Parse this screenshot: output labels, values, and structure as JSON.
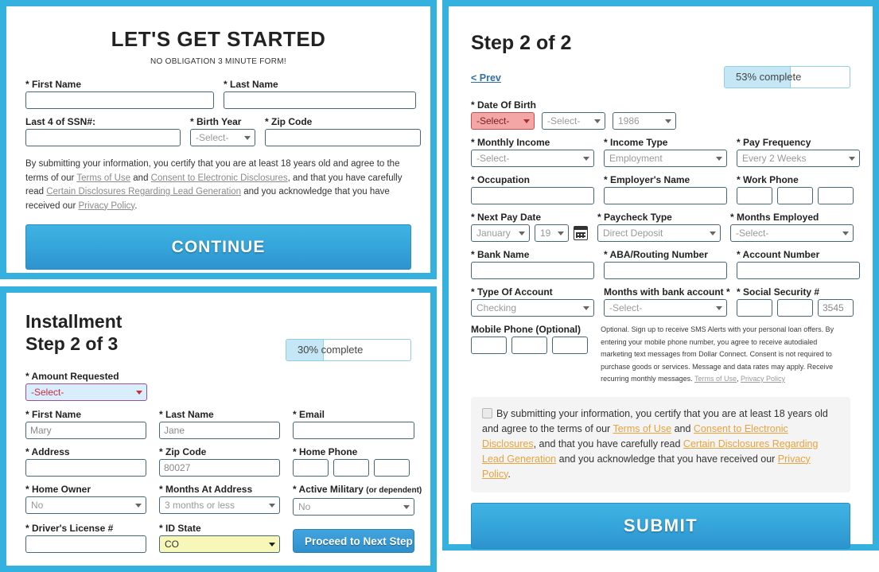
{
  "theme": {
    "frame_blue": "#35b1e0",
    "button_blue": "#35a5da",
    "link_orange": "#e8a33d",
    "error_red": "#f4a6a6",
    "highlight_yellow": "#f7f7b9",
    "progress_fill": "#c5e7f5"
  },
  "start_panel": {
    "title": "LET'S GET STARTED",
    "subtitle": "NO OBLIGATION 3 MINUTE FORM!",
    "fields": {
      "first_name_label": "* First Name",
      "first_name_value": "",
      "last_name_label": "* Last Name",
      "last_name_value": "",
      "ssn_label": "Last 4 of SSN#:",
      "ssn_value": "",
      "birth_year_label": "* Birth Year",
      "birth_year_value": "-Select-",
      "zip_label": "* Zip Code",
      "zip_value": ""
    },
    "disclaimer": {
      "p1": "By submitting your information, you certify that you are at least 18 years old and agree to the terms of our ",
      "link_terms": "Terms of Use",
      "p2": " and ",
      "link_consent": "Consent to Electronic Disclosures",
      "p3": ", and that you have carefully read ",
      "link_lead": "Certain Disclosures Regarding Lead Generation",
      "p4": " and you acknowledge that you have received our ",
      "link_privacy": "Privacy Policy",
      "p5": "."
    },
    "continue_label": "CONTINUE"
  },
  "installment_panel": {
    "title_line1": "Installment",
    "title_line2": "Step 2 of 3",
    "progress_text": "30% complete",
    "progress_percent": 30,
    "fields": {
      "amount_label": "* Amount Requested",
      "amount_value": "-Select-",
      "first_name_label": "* First Name",
      "first_name_value": "Mary",
      "last_name_label": "* Last Name",
      "last_name_value": "Jane",
      "email_label": "* Email",
      "email_value": "",
      "address_label": "* Address",
      "address_value": "",
      "zip_label": "* Zip Code",
      "zip_value": "80027",
      "home_phone_label": "* Home Phone",
      "home_phone_1": "",
      "home_phone_2": "",
      "home_phone_3": "",
      "home_owner_label": "* Home Owner",
      "home_owner_value": "No",
      "months_address_label": "* Months At Address",
      "months_address_value": "3 months or less",
      "military_label": "* Active Military ",
      "military_label_sub": "(or dependent)",
      "military_value": "No",
      "drivers_license_label": "* Driver's License #",
      "drivers_license_value": "",
      "id_state_label": "* ID State",
      "id_state_value": "CO"
    },
    "proceed_label": "Proceed to Next Step"
  },
  "step2_panel": {
    "title": "Step 2 of 2",
    "prev_label": "< Prev",
    "progress_text": "53% complete",
    "progress_percent": 53,
    "fields": {
      "dob_label": "* Date Of Birth",
      "dob_month": "-Select-",
      "dob_day": "-Select-",
      "dob_year": "1986",
      "monthly_income_label": "* Monthly Income",
      "monthly_income_value": "-Select-",
      "income_type_label": "* Income Type",
      "income_type_value": "Employment",
      "pay_frequency_label": "* Pay Frequency",
      "pay_frequency_value": "Every 2 Weeks",
      "occupation_label": "* Occupation",
      "occupation_value": "",
      "employer_label": "* Employer's Name",
      "employer_value": "",
      "work_phone_label": "* Work Phone",
      "work_phone_1": "",
      "work_phone_2": "",
      "work_phone_3": "",
      "next_pay_date_label": "* Next Pay Date",
      "next_pay_month": "January",
      "next_pay_day": "19",
      "paycheck_type_label": "* Paycheck Type",
      "paycheck_type_value": "Direct Deposit",
      "months_employed_label": "* Months Employed",
      "months_employed_value": "-Select-",
      "bank_name_label": "* Bank Name",
      "bank_name_value": "",
      "aba_label": "* ABA/Routing Number",
      "aba_value": "",
      "account_number_label": "* Account Number",
      "account_number_value": "",
      "account_type_label": "* Type Of Account",
      "account_type_value": "Checking",
      "months_bank_label": "Months with bank account *",
      "months_bank_value": "-Select-",
      "ssn_label": "* Social Security #",
      "ssn_1": "",
      "ssn_2": "",
      "ssn_3": "3545",
      "mobile_label": "Mobile Phone (Optional)",
      "mobile_1": "",
      "mobile_2": "",
      "mobile_3": ""
    },
    "sms_note": {
      "text": "Optional. Sign up to receive SMS Alerts with your personal loan offers. By entering your mobile phone number, you agree to receive autodialed marketing text messages from Dollar Connect. Consent is not required to purchase goods or services. Message and data rates may apply. Receive recurring monthly messages. ",
      "link_terms": "Terms of Use",
      "sep": ", ",
      "link_privacy": "Privacy Policy"
    },
    "consent": {
      "p1": "By submitting your information, you certify that you are at least 18 years old and agree to the terms of our ",
      "link_terms": "Terms of Use",
      "p2": " and ",
      "link_consent": "Consent to Electronic Disclosures",
      "p3": ", and that you have carefully read ",
      "link_lead": "Certain Disclosures Regarding Lead Generation",
      "p4": " and you acknowledge that you have received our ",
      "link_privacy": "Privacy Policy",
      "p5": "."
    },
    "submit_label": "SUBMIT"
  }
}
